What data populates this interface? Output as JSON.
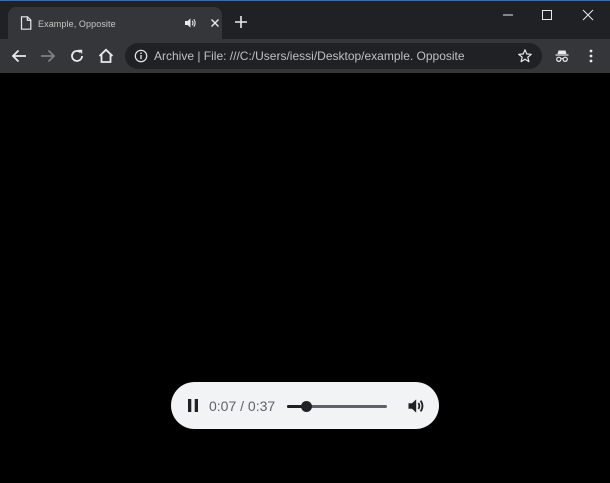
{
  "tab": {
    "title": "Example, Opposite",
    "page_icon": "page-icon",
    "audio_icon": "speaker-icon",
    "close_icon": "close-icon"
  },
  "new_tab": {
    "icon": "plus-icon"
  },
  "window_controls": [
    "minimize-icon",
    "maximize-icon",
    "close-icon"
  ],
  "toolbar": {
    "url": "Archive | File: ///C:/Users/iessi/Desktop/example. Opposite",
    "back_icon": "back-arrow-icon",
    "forward_icon": "forward-arrow-icon",
    "reload_icon": "reload-icon",
    "home_icon": "home-icon",
    "info_icon": "info-icon",
    "star_icon": "star-icon",
    "incognito_icon": "incognito-icon",
    "menu_icon": "kebab-menu-icon"
  },
  "player": {
    "time": "0:07 / 0:37",
    "progress_fraction": 0.19,
    "play_pause_icon": "pause-icon",
    "volume_icon": "volume-icon"
  },
  "colors": {
    "titlebar": "#202124",
    "tab_active": "#35363a",
    "toolbar": "#35363a",
    "omnibox": "#202124",
    "content_bg": "#000000",
    "player_bg": "#f1f3f4"
  }
}
